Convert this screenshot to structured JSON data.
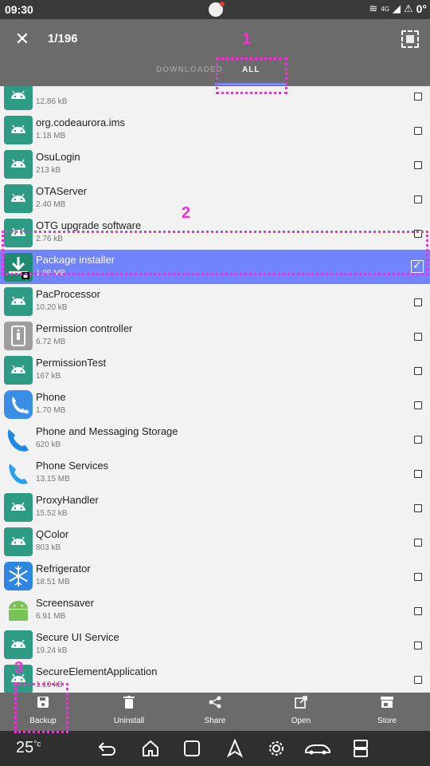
{
  "status_bar": {
    "time": "09:30",
    "network": "4G",
    "extra_number": "0°"
  },
  "header": {
    "close_label": "✕",
    "counter": "1/196",
    "tabs": [
      {
        "label": "DOWNLOADED",
        "active": false
      },
      {
        "label": "ALL",
        "active": true
      }
    ]
  },
  "apps": [
    {
      "name": "",
      "size": "12.86 kB",
      "checked": false,
      "icon": "android-icon"
    },
    {
      "name": "org.codeaurora.ims",
      "size": "1.18 MB",
      "checked": false,
      "icon": "android-icon"
    },
    {
      "name": "OsuLogin",
      "size": "213 kB",
      "checked": false,
      "icon": "android-icon"
    },
    {
      "name": "OTAServer",
      "size": "2.40 MB",
      "checked": false,
      "icon": "android-icon"
    },
    {
      "name": "OTG upgrade software",
      "size": "2.76 kB",
      "checked": false,
      "icon": "android-icon"
    },
    {
      "name": "Package installer",
      "size": "1.99 MB",
      "checked": true,
      "icon": "package-installer-icon"
    },
    {
      "name": "PacProcessor",
      "size": "10.20 kB",
      "checked": false,
      "icon": "android-icon"
    },
    {
      "name": "Permission controller",
      "size": "6.72 MB",
      "checked": false,
      "icon": "permission-icon"
    },
    {
      "name": "PermissionTest",
      "size": "167 kB",
      "checked": false,
      "icon": "android-icon"
    },
    {
      "name": "Phone",
      "size": "1.70 MB",
      "checked": false,
      "icon": "phone-icon"
    },
    {
      "name": "Phone and Messaging Storage",
      "size": "620 kB",
      "checked": false,
      "icon": "phone-storage-icon"
    },
    {
      "name": "Phone Services",
      "size": "13.15 MB",
      "checked": false,
      "icon": "phone-services-icon"
    },
    {
      "name": "ProxyHandler",
      "size": "15.52 kB",
      "checked": false,
      "icon": "android-icon"
    },
    {
      "name": "QColor",
      "size": "803 kB",
      "checked": false,
      "icon": "android-icon"
    },
    {
      "name": "Refrigerator",
      "size": "18.51 MB",
      "checked": false,
      "icon": "snowflake-icon"
    },
    {
      "name": "Screensaver",
      "size": "6.91 MB",
      "checked": false,
      "icon": "android-green-icon"
    },
    {
      "name": "Secure UI Service",
      "size": "19.24 kB",
      "checked": false,
      "icon": "android-icon"
    },
    {
      "name": "SecureElementApplication",
      "size": "1.19 kB",
      "checked": false,
      "icon": "android-icon"
    }
  ],
  "actions": [
    {
      "label": "Backup",
      "icon": "save-icon"
    },
    {
      "label": "Uninstall",
      "icon": "trash-icon"
    },
    {
      "label": "Share",
      "icon": "share-icon"
    },
    {
      "label": "Open",
      "icon": "open-external-icon"
    },
    {
      "label": "Store",
      "icon": "store-icon"
    }
  ],
  "nav_bar": {
    "temperature": "25",
    "temperature_unit": "°c"
  },
  "annotations": [
    "1",
    "2",
    "3"
  ],
  "colors": {
    "selected_row": "#7184fb",
    "annotation": "#ff2bd6",
    "app_bar": "#6b6b6b",
    "android_icon": "#2e9b84"
  }
}
